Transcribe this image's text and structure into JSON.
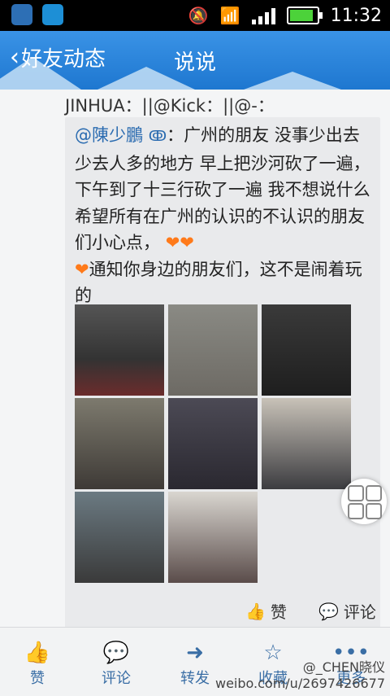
{
  "status_bar": {
    "time": "11:32"
  },
  "header": {
    "back_label": "好友动态",
    "title": "说说"
  },
  "feed": {
    "repost_line": "JINHUA：||@Kick：||@-：",
    "author": "@陳少鵬",
    "text": "：广州的朋友 没事少出去 少去人多的地方 早上把沙河砍了一遍，下午到了十三行砍了一遍 我不想说什么 希望所有在广州的认识的不认识的朋友们小心点，",
    "text2": "通知你身边的朋友们，这不是闹着玩的",
    "photos": [
      "photo-1",
      "photo-2",
      "photo-3",
      "photo-4",
      "photo-5",
      "photo-6",
      "photo-7",
      "photo-8"
    ]
  },
  "actions": {
    "like": "赞",
    "comment": "评论"
  },
  "bottom_nav": {
    "like": "赞",
    "comment": "评论",
    "forward": "转发",
    "favorite": "收藏",
    "more": "更多"
  },
  "watermark": "weibo.com/u/2697426677",
  "watermark_user": "@_CHEN晓仪"
}
